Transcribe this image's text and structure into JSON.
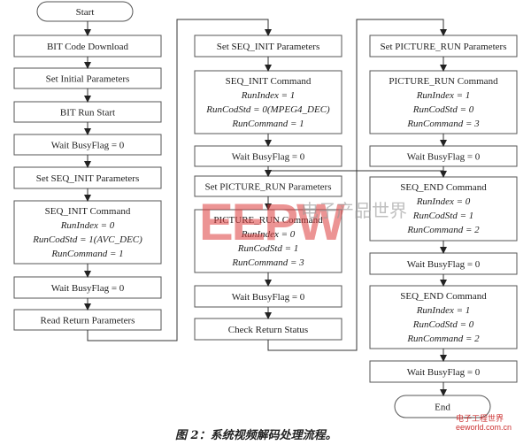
{
  "col1": [
    {
      "title": "BIT Code Download"
    },
    {
      "title": "Set Initial Parameters"
    },
    {
      "title": "BIT Run Start"
    },
    {
      "title": "Wait BusyFlag = 0"
    },
    {
      "title": "Set SEQ_INIT Parameters"
    },
    {
      "title": "SEQ_INIT Command",
      "lines": [
        "RunIndex = 0",
        "RunCodStd = 1(AVC_DEC)",
        "RunCommand = 1"
      ]
    },
    {
      "title": "Wait BusyFlag = 0"
    },
    {
      "title": "Read Return Parameters"
    }
  ],
  "col2": [
    {
      "title": "Set SEQ_INIT Parameters"
    },
    {
      "title": "SEQ_INIT Command",
      "lines": [
        "RunIndex = 1",
        "RunCodStd = 0(MPEG4_DEC)",
        "RunCommand = 1"
      ]
    },
    {
      "title": "Wait BusyFlag = 0"
    },
    {
      "title": "Set PICTURE_RUN Parameters"
    },
    {
      "title": "PICTURE_RUN Command",
      "lines": [
        "RunIndex = 0",
        "RunCodStd = 1",
        "RunCommand = 3"
      ]
    },
    {
      "title": "Wait BusyFlag = 0"
    },
    {
      "title": "Check Return Status"
    }
  ],
  "col3": [
    {
      "title": "Set PICTURE_RUN Parameters"
    },
    {
      "title": "PICTURE_RUN Command",
      "lines": [
        "RunIndex = 1",
        "RunCodStd = 0",
        "RunCommand = 3"
      ]
    },
    {
      "title": "Wait BusyFlag = 0"
    },
    {
      "title": "SEQ_END Command",
      "lines": [
        "RunIndex = 0",
        "RunCodStd = 1",
        "RunCommand = 2"
      ]
    },
    {
      "title": "Wait BusyFlag = 0"
    },
    {
      "title": "SEQ_END Command",
      "lines": [
        "RunIndex = 1",
        "RunCodStd = 0",
        "RunCommand = 2"
      ]
    },
    {
      "title": "Wait BusyFlag = 0"
    }
  ],
  "start": "Start",
  "end": "End",
  "caption": "图 2：系统视频解码处理流程。",
  "watermark": {
    "brand": "EEPW",
    ".com": ".com.cn",
    "cn": "电子产品世界"
  },
  "logo": {
    "line1": "电子工程世界",
    "line2": "eeworld.com.cn"
  }
}
